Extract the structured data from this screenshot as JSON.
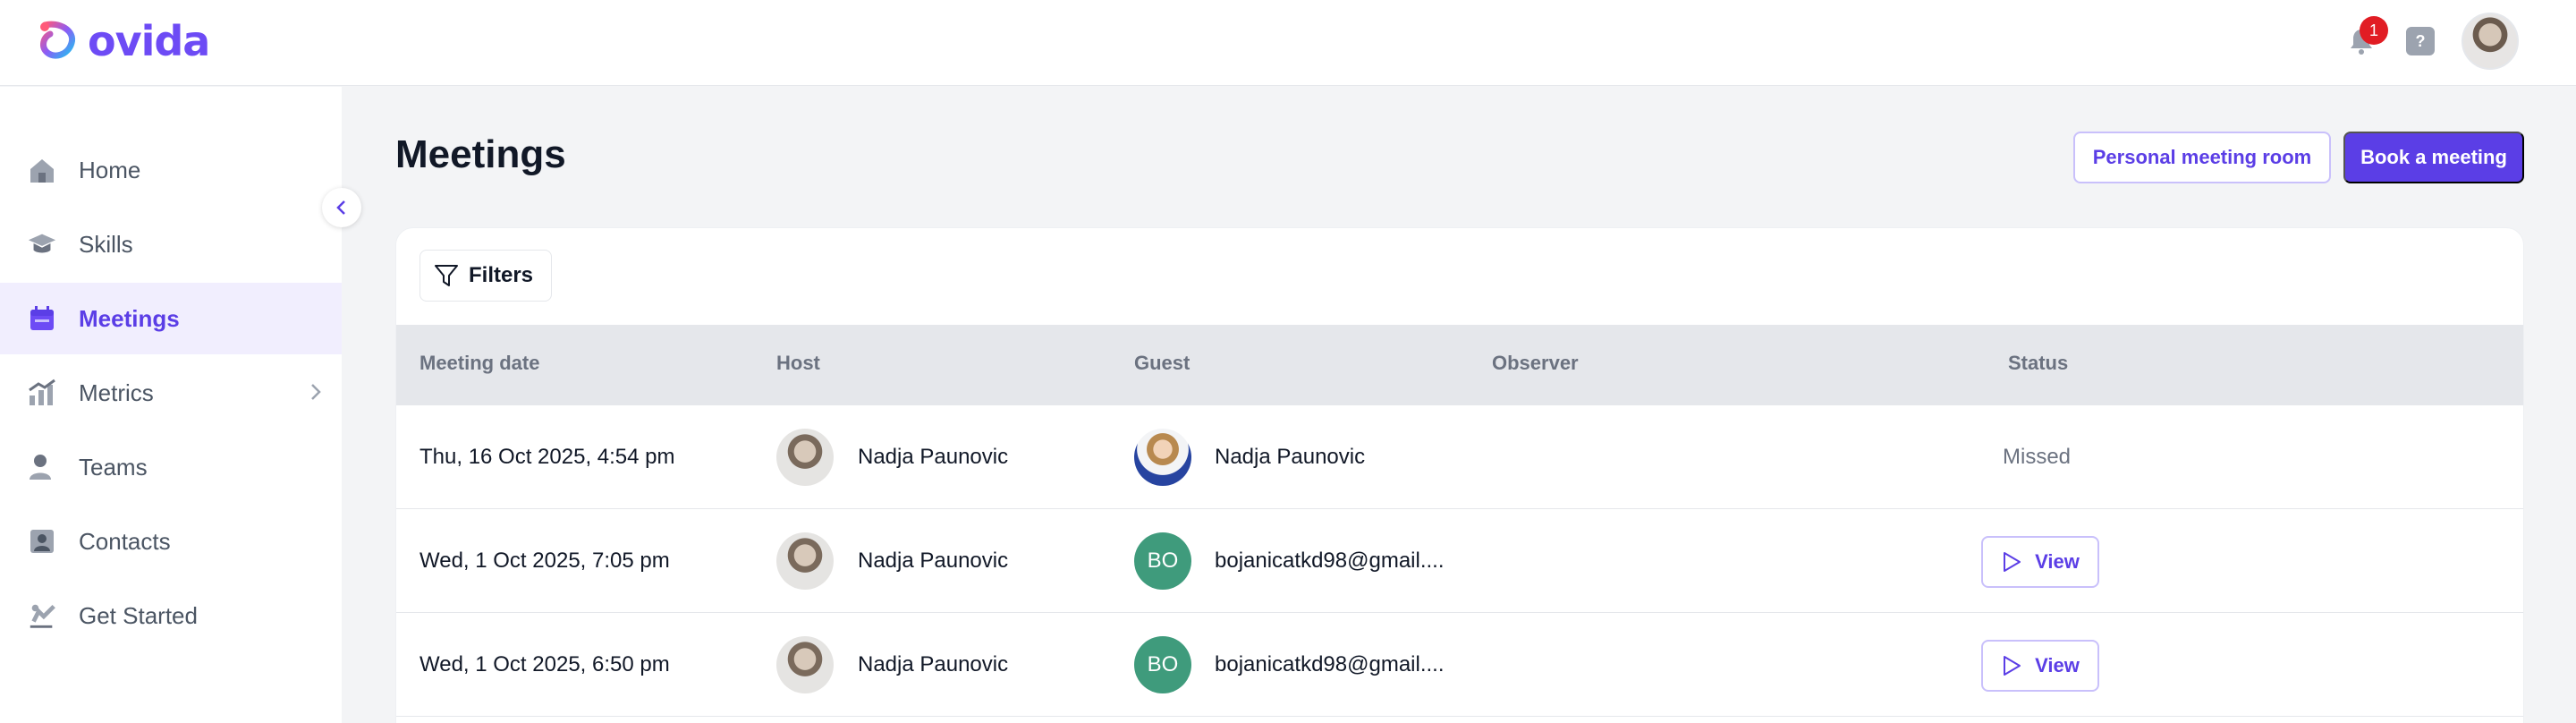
{
  "app": {
    "logo_text": "ovida"
  },
  "header": {
    "notification_count": "1",
    "help_label": "?"
  },
  "sidebar": {
    "items": [
      {
        "label": "Home",
        "icon": "home-icon"
      },
      {
        "label": "Skills",
        "icon": "graduation-cap-icon"
      },
      {
        "label": "Meetings",
        "icon": "calendar-icon",
        "active": true
      },
      {
        "label": "Metrics",
        "icon": "chart-icon",
        "has_submenu": true
      },
      {
        "label": "Teams",
        "icon": "users-icon"
      },
      {
        "label": "Contacts",
        "icon": "contact-card-icon"
      },
      {
        "label": "Get Started",
        "icon": "rocket-icon"
      }
    ]
  },
  "page": {
    "title": "Meetings",
    "personal_room_label": "Personal meeting room",
    "book_label": "Book a meeting",
    "filters_label": "Filters"
  },
  "table": {
    "columns": [
      "Meeting date",
      "Host",
      "Guest",
      "Observer",
      "Status"
    ],
    "rows": [
      {
        "date": "Thu, 16 Oct 2025, 4:54 pm",
        "host": "Nadja Paunovic",
        "guest": "Nadja Paunovic",
        "guest_avatar": "photo",
        "status": "Missed"
      },
      {
        "date": "Wed, 1 Oct 2025, 7:05 pm",
        "host": "Nadja Paunovic",
        "guest": "bojanicatkd98@gmail....",
        "guest_initials": "BO",
        "action": "View"
      },
      {
        "date": "Wed, 1 Oct 2025, 6:50 pm",
        "host": "Nadja Paunovic",
        "guest": "bojanicatkd98@gmail....",
        "guest_initials": "BO",
        "action": "View"
      }
    ]
  },
  "colors": {
    "accent": "#5b3ee6",
    "active_bg": "#f1eefe",
    "badge": "#e11d24",
    "initials_bg": "#3f9b7c"
  }
}
